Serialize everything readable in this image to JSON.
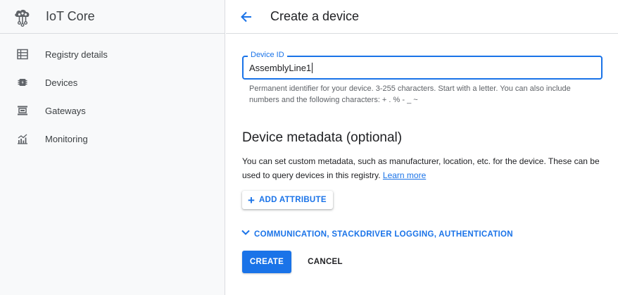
{
  "sidebar": {
    "product_title": "IoT Core",
    "product_icon": "iot-core-icon",
    "items": [
      {
        "label": "Registry details",
        "icon": "registry-icon"
      },
      {
        "label": "Devices",
        "icon": "device-chip-icon"
      },
      {
        "label": "Gateways",
        "icon": "gateway-icon"
      },
      {
        "label": "Monitoring",
        "icon": "monitoring-chart-icon"
      }
    ]
  },
  "header": {
    "title": "Create a device",
    "back_icon": "arrow-back-icon"
  },
  "form": {
    "device_id": {
      "label": "Device ID",
      "value": "AssemblyLine1",
      "helper": "Permanent identifier for your device. 3-255 characters. Start with a letter. You can also include numbers and the following characters: + . % - _ ~"
    },
    "metadata": {
      "title": "Device metadata (optional)",
      "description": "You can set custom metadata, such as manufacturer, location, etc. for the device. These can be used to query devices in this registry.",
      "learn_more": "Learn more"
    },
    "add_attribute_label": "ADD ATTRIBUTE",
    "expander_label": "COMMUNICATION, STACKDRIVER LOGGING, AUTHENTICATION",
    "create_label": "CREATE",
    "cancel_label": "CANCEL"
  },
  "colors": {
    "accent": "#1a73e8",
    "sidebar_bg": "#f8f9fa",
    "icon": "#5f6368"
  }
}
